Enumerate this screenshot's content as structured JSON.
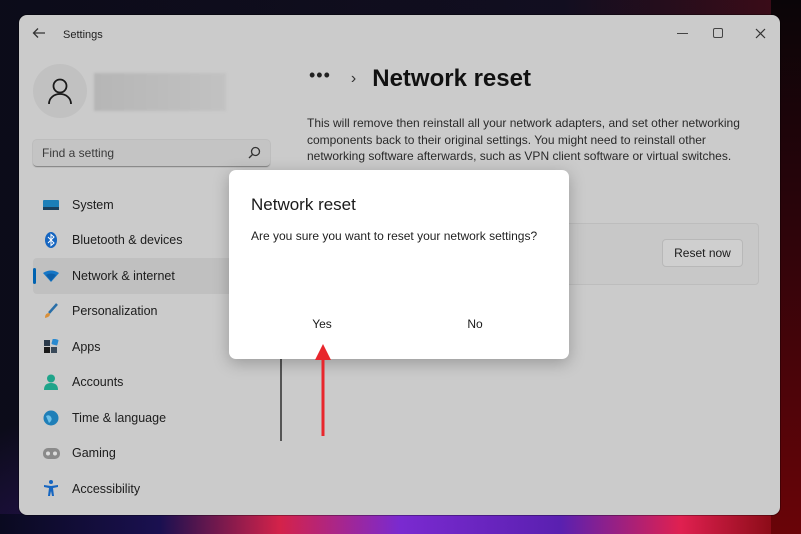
{
  "window": {
    "app_title": "Settings",
    "controls": {
      "minimize": "minimize",
      "maximize": "maximize",
      "close": "close"
    }
  },
  "sidebar": {
    "search": {
      "placeholder": "Find a setting",
      "value": ""
    },
    "items": [
      {
        "label": "System",
        "icon": "monitor-icon",
        "active": false
      },
      {
        "label": "Bluetooth & devices",
        "icon": "bluetooth-icon",
        "active": false
      },
      {
        "label": "Network & internet",
        "icon": "wifi-icon",
        "active": true
      },
      {
        "label": "Personalization",
        "icon": "brush-icon",
        "active": false
      },
      {
        "label": "Apps",
        "icon": "apps-icon",
        "active": false
      },
      {
        "label": "Accounts",
        "icon": "person-icon",
        "active": false
      },
      {
        "label": "Time & language",
        "icon": "globe-icon",
        "active": false
      },
      {
        "label": "Gaming",
        "icon": "gamepad-icon",
        "active": false
      },
      {
        "label": "Accessibility",
        "icon": "accessibility-icon",
        "active": false
      }
    ]
  },
  "main": {
    "breadcrumb_more": "•••",
    "breadcrumb_sep": "›",
    "title": "Network reset",
    "description": "This will remove then reinstall all your network adapters, and set other networking components back to their original settings. You might need to reinstall other networking software afterwards, such as VPN client software or virtual switches.",
    "reset_button": "Reset now"
  },
  "dialog": {
    "title": "Network reset",
    "message": "Are you sure you want to reset your network settings?",
    "yes_label": "Yes",
    "no_label": "No"
  },
  "colors": {
    "accent": "#0063b1",
    "annotation_arrow": "#e8262c"
  }
}
